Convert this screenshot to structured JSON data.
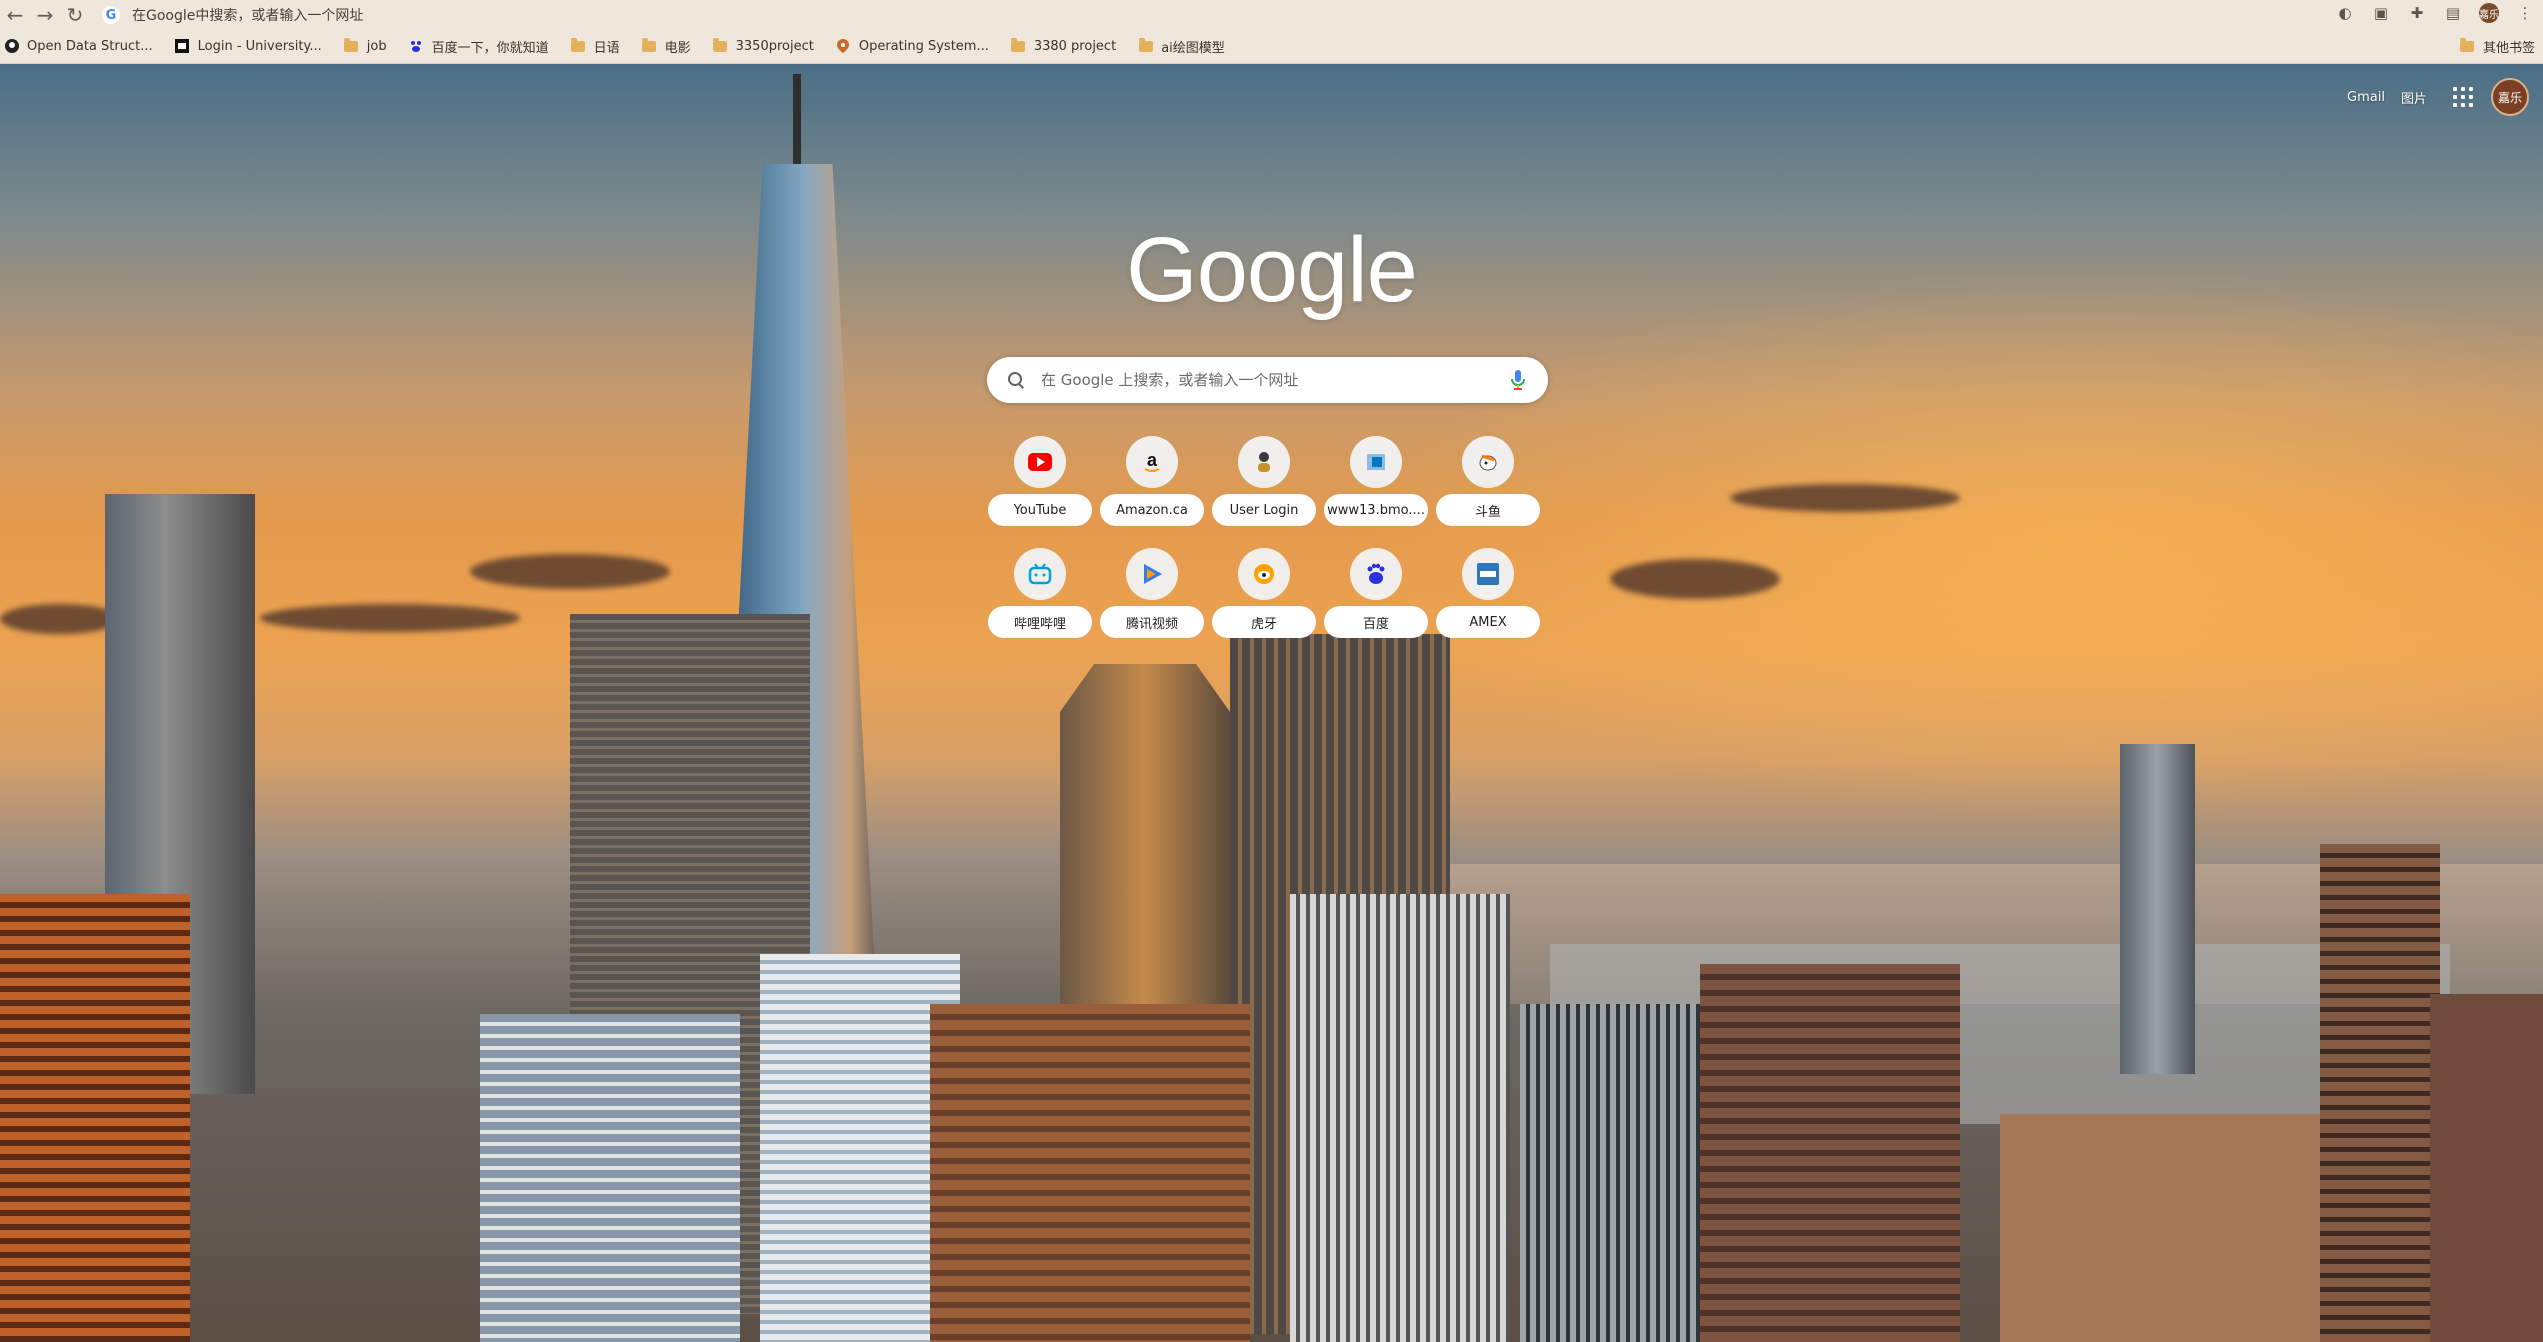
{
  "toolbar": {
    "omnibox_text": "在Google中搜索，或者输入一个网址",
    "profile_initials": "嘉乐"
  },
  "bookmarks": [
    {
      "label": "Open Data Struct...",
      "icon": "github-icon"
    },
    {
      "label": "Login - University...",
      "icon": "university-icon"
    },
    {
      "label": "job",
      "icon": "folder-icon"
    },
    {
      "label": "百度一下，你就知道",
      "icon": "baidu-icon"
    },
    {
      "label": "日语",
      "icon": "folder-icon"
    },
    {
      "label": "电影",
      "icon": "folder-icon"
    },
    {
      "label": "3350project",
      "icon": "folder-icon"
    },
    {
      "label": "Operating System...",
      "icon": "location-pin-icon"
    },
    {
      "label": "3380 project",
      "icon": "folder-icon"
    },
    {
      "label": "ai绘图模型",
      "icon": "folder-icon"
    }
  ],
  "bookmarks_other": "其他书签",
  "header": {
    "gmail": "Gmail",
    "images": "图片",
    "avatar_initials": "嘉乐"
  },
  "logo": "Google",
  "search": {
    "placeholder": "在 Google 上搜索，或者输入一个网址"
  },
  "shortcuts": [
    {
      "label": "YouTube",
      "icon": "youtube-icon",
      "color": "#ff0000"
    },
    {
      "label": "Amazon.ca",
      "icon": "amazon-icon",
      "color": "#111111"
    },
    {
      "label": "User Login",
      "icon": "user-login-icon",
      "color": "#3a3a3a"
    },
    {
      "label": "www13.bmo....",
      "icon": "bmo-icon",
      "color": "#0079c1"
    },
    {
      "label": "斗鱼",
      "icon": "douyu-icon",
      "color": "#ff7a00"
    },
    {
      "label": "哔哩哔哩",
      "icon": "bilibili-icon",
      "color": "#00a1d6"
    },
    {
      "label": "腾讯视频",
      "icon": "tencent-video-icon",
      "color": "#2f7cf6"
    },
    {
      "label": "虎牙",
      "icon": "huya-icon",
      "color": "#ffa200"
    },
    {
      "label": "百度",
      "icon": "baidu-icon",
      "color": "#2932e1"
    },
    {
      "label": "AMEX",
      "icon": "amex-icon",
      "color": "#2e77bb"
    }
  ]
}
